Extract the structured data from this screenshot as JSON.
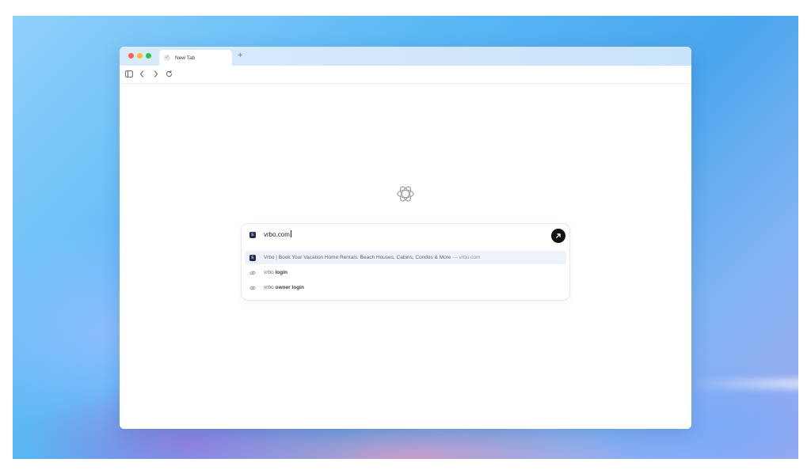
{
  "browser": {
    "tab": {
      "title": "New Tab",
      "favicon": "checkmark-icon"
    },
    "new_tab_label": "+",
    "toolbar": {
      "icons": [
        "sidebar-icon",
        "back-icon",
        "forward-icon",
        "reload-icon"
      ]
    }
  },
  "page": {
    "logo": "openai-logo-icon"
  },
  "omnibox": {
    "input_value": "vrbo.com",
    "site_icon_letter": "E",
    "go_icon": "arrow-up-right-icon",
    "suggestions": [
      {
        "icon": "site-favicon",
        "title": "Vrbo | Book Your Vacation Home Rentals: Beach Houses, Cabins, Condos & More",
        "separator": "—",
        "url": "vrbo.com",
        "active": true
      },
      {
        "icon": "link-icon",
        "prefix": "vrbo",
        "bold": "login"
      },
      {
        "icon": "link-icon",
        "prefix": "vrbo",
        "bold": "owner login"
      }
    ]
  },
  "colors": {
    "go_button": "#111111",
    "active_suggestion": "#eef3fb",
    "tabbar": "#d2e7fa"
  }
}
